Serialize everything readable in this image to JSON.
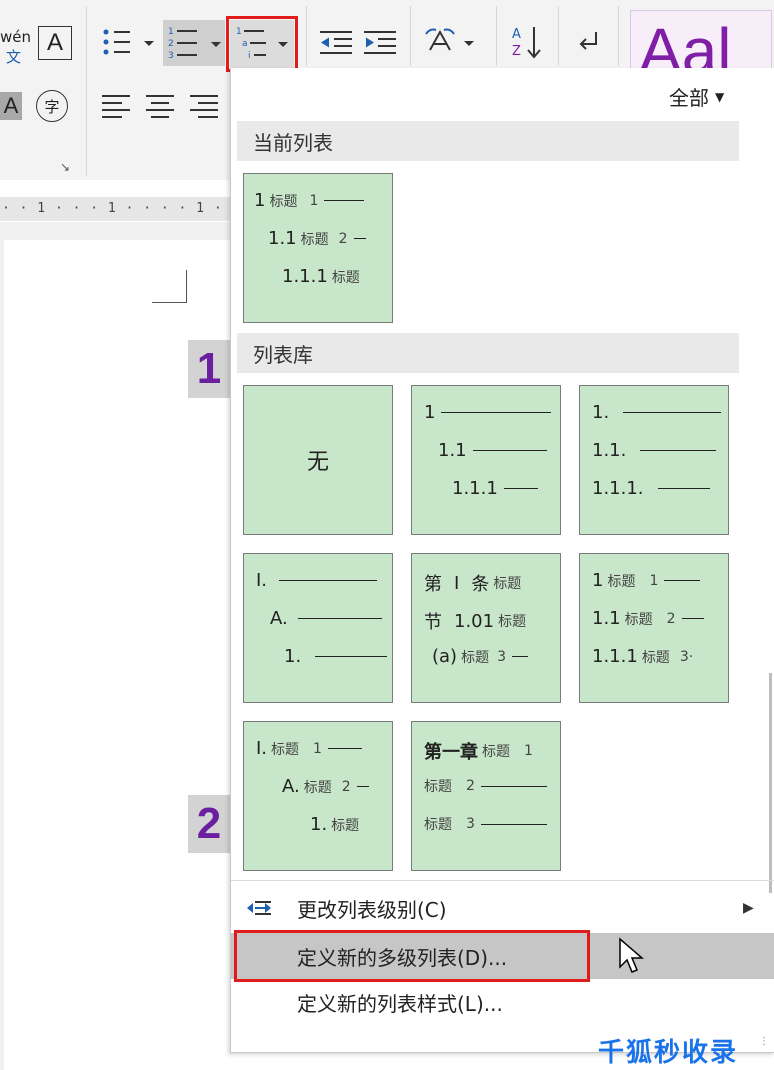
{
  "ribbon": {
    "phonetic_top": "wén",
    "phonetic_bottom": "文",
    "char_border": "A",
    "shading": "A",
    "enclose": "字",
    "style_preview": "Aal"
  },
  "ruler": {
    "ticks": "· · 1 · · · 1 · · · · 1 · · ·  · · ·"
  },
  "page_numbers": {
    "first": "1",
    "second": "2"
  },
  "panel": {
    "filter_label": "全部",
    "current_list_heading": "当前列表",
    "library_heading": "列表库",
    "current_tile": {
      "l1": "1",
      "l1t": "标题",
      "l1n": "1",
      "l2": "1.1",
      "l2t": "标题",
      "l2n": "2",
      "l3": "1.1.1",
      "l3t": "标题"
    },
    "tiles": {
      "none": "无",
      "t2": {
        "l1": "1",
        "l2": "1.1",
        "l3": "1.1.1"
      },
      "t3": {
        "l1": "1.",
        "l2": "1.1.",
        "l3": "1.1.1."
      },
      "t4": {
        "l1": "I.",
        "l2": "A.",
        "l3": "1."
      },
      "t5": {
        "l1a": "第",
        "l1b": "I",
        "l1c": "条",
        "l1t": "标题",
        "l2a": "节",
        "l2b": "1.01",
        "l2t": "标题",
        "l3a": "(a)",
        "l3t": "标题",
        "l3n": "3"
      },
      "t6": {
        "l1": "1",
        "l1t": "标题",
        "l1n": "1",
        "l2": "1.1",
        "l2t": "标题",
        "l2n": "2",
        "l3": "1.1.1",
        "l3t": "标题",
        "l3n": "3·"
      },
      "t7": {
        "l1": "I.",
        "l1t": "标题",
        "l1n": "1",
        "l2": "A.",
        "l2t": "标题",
        "l2n": "2",
        "l3": "1.",
        "l3t": "标题"
      },
      "t8": {
        "l1": "第一章",
        "l1t": "标题",
        "l1n": "1",
        "l2t": "标题",
        "l2n": "2",
        "l3t": "标题",
        "l3n": "3"
      }
    },
    "menu": {
      "change_level": "更改列表级别(C)",
      "define_multilevel": "定义新的多级列表(D)...",
      "define_style": "定义新的列表样式(L)..."
    }
  },
  "watermark": "千狐秒收录",
  "colors": {
    "tile": "#c8e6c9",
    "highlight": "#e21b1b",
    "accent": "#7f1fa6"
  }
}
